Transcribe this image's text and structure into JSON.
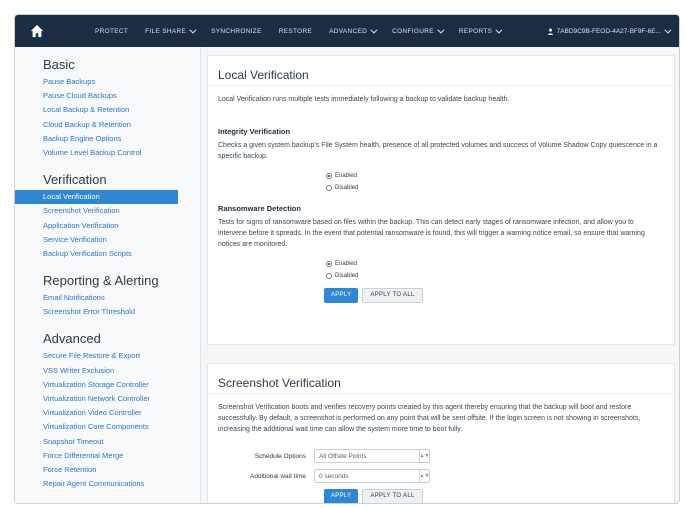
{
  "nav": {
    "items": [
      {
        "label": "PROTECT",
        "dropdown": false
      },
      {
        "label": "FILE SHARE",
        "dropdown": true
      },
      {
        "label": "SYNCHRONIZE",
        "dropdown": false
      },
      {
        "label": "RESTORE",
        "dropdown": false
      },
      {
        "label": "ADVANCED",
        "dropdown": true
      },
      {
        "label": "CONFIGURE",
        "dropdown": true
      },
      {
        "label": "REPORTS",
        "dropdown": true
      }
    ],
    "account_label": "7ABD9C9B-FEOD-4A27-BF9F-6E..."
  },
  "sidebar": {
    "groups": [
      {
        "title": "Basic",
        "items": [
          "Pause Backups",
          "Pause Cloud Backups",
          "Local Backup & Retention",
          "Cloud Backup & Retention",
          "Backup Engine Options",
          "Volume Level Backup Control"
        ]
      },
      {
        "title": "Verification",
        "items": [
          "Local Verification",
          "Screenshot Verification",
          "Application Verification",
          "Service Verification",
          "Backup Verification Scripts"
        ]
      },
      {
        "title": "Reporting & Alerting",
        "items": [
          "Email Notifications",
          "Screenshot Error Threshold"
        ]
      },
      {
        "title": "Advanced",
        "items": [
          "Secure File Restore & Export",
          "VSS Writer Exclusion",
          "Virtualization Storage Controller",
          "Virtualization Network Controller",
          "Virtualization Video Controller",
          "Virtualization Core Components",
          "Snapshot Timeout",
          "Force Differential Merge",
          "Force Retention",
          "Repair Agent Communications"
        ]
      }
    ],
    "active_item": "Local Verification"
  },
  "local_verification": {
    "title": "Local Verification",
    "description": "Local Verification runs multiple tests immediately following a backup to validate backup health.",
    "integrity": {
      "title": "Integrity Verification",
      "description": "Checks a given system backup's File System health, presence of all protected volumes and success of Volume Shadow Copy quiescence in a specific backup.",
      "option_enabled": "Enabled",
      "option_disabled": "Disabled",
      "selected": "Enabled"
    },
    "ransomware": {
      "title": "Ransomware Detection",
      "description": "Tests for signs of ransomware based on files within the backup. This can detect early stages of ransomware infection, and allow you to intervene before it spreads. In the event that potential ransomware is found, this will trigger a warning notice email, so ensure that warning notices are monitored.",
      "option_enabled": "Enabled",
      "option_disabled": "Disabled",
      "selected": "Enabled"
    },
    "apply_label": "APPLY",
    "apply_all_label": "APPLY TO ALL"
  },
  "screenshot_verification": {
    "title": "Screenshot Verification",
    "description": "Screenshot Verification boots and verifies recovery points created by this agent thereby ensuring that the backup will boot and restore successfully. By default, a screenshot is performed on any point that will be sent offsite. If the login screen is not showing in screenshots, increasing the additional wait time can allow the system more time to boot fully.",
    "schedule_label": "Schedule Options",
    "schedule_value": "All Offsite Points",
    "wait_label": "Additional wait time",
    "wait_value": "0 seconds",
    "apply_label": "APPLY",
    "apply_all_label": "APPLY TO ALL"
  },
  "colors": {
    "topbar": "#1b2d42",
    "accent": "#2f86d2",
    "link": "#2b76c7"
  }
}
